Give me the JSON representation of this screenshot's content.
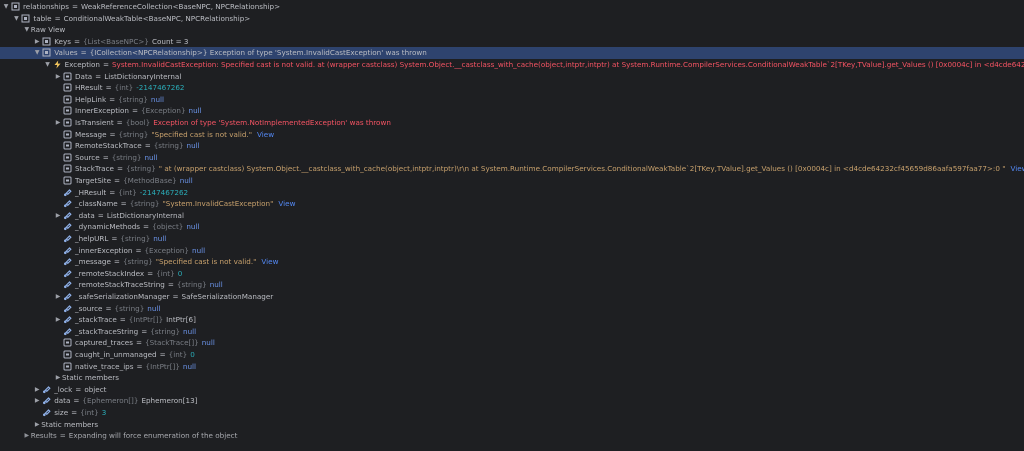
{
  "colors": {
    "background": "#1e1f22",
    "selection": "#2e436e",
    "text": "#bcbec4",
    "type_hint": "#7a7e85",
    "number": "#2aacb8",
    "keyword": "#6c95eb",
    "string": "#c9a26d",
    "error": "#f75464",
    "link": "#548af7"
  },
  "rows": [
    {
      "depth": 0,
      "arrow": "down",
      "icon": "object-icon",
      "name": "relationships",
      "type": "",
      "value": "WeakReferenceCollection<BaseNPC, NPCRelationship>",
      "vclass": "plain",
      "view": ""
    },
    {
      "depth": 1,
      "arrow": "down",
      "icon": "object-icon",
      "name": "table",
      "type": "",
      "value": "ConditionalWeakTable<BaseNPC, NPCRelationship>",
      "vclass": "plain",
      "view": ""
    },
    {
      "depth": 2,
      "arrow": "down",
      "icon": "",
      "name": "Raw View",
      "type": "",
      "value": "",
      "vclass": "plain",
      "view": "",
      "eq": false
    },
    {
      "depth": 3,
      "arrow": "right",
      "icon": "object-icon",
      "name": "Keys",
      "type": "{List<BaseNPC>}",
      "value": "Count = 3",
      "vclass": "plain",
      "view": ""
    },
    {
      "depth": 3,
      "arrow": "down",
      "icon": "object-icon",
      "name": "Values",
      "type": "",
      "value": "{ICollection<NPCRelationship>} Exception of type 'System.InvalidCastException' was thrown",
      "vclass": "plain",
      "view": "",
      "selected": true
    },
    {
      "depth": 4,
      "arrow": "down",
      "icon": "exception-icon",
      "name": "Exception",
      "type": "",
      "value": "System.InvalidCastException: Specified cast is not valid.  at (wrapper castclass) System.Object.__castclass_with_cache(object,intptr,intptr)  at System.Runtime.CompilerServices.ConditionalWeakTable`2[TKey,TValue].get_Values () [0x0004c] in <d4cde64232...",
      "vclass": "err",
      "view": ""
    },
    {
      "depth": 5,
      "arrow": "right",
      "icon": "field-icon",
      "name": "Data",
      "type": "",
      "value": "ListDictionaryInternal",
      "vclass": "plain",
      "view": ""
    },
    {
      "depth": 5,
      "arrow": "none",
      "icon": "field-icon",
      "name": "HResult",
      "type": "{int}",
      "value": "-2147467262",
      "vclass": "num",
      "view": ""
    },
    {
      "depth": 5,
      "arrow": "none",
      "icon": "field-icon",
      "name": "HelpLink",
      "type": "{string}",
      "value": "null",
      "vclass": "kw",
      "view": ""
    },
    {
      "depth": 5,
      "arrow": "none",
      "icon": "field-icon",
      "name": "InnerException",
      "type": "{Exception}",
      "value": "null",
      "vclass": "kw",
      "view": ""
    },
    {
      "depth": 5,
      "arrow": "right",
      "icon": "field-icon",
      "name": "IsTransient",
      "type": "{bool}",
      "value": "Exception of type 'System.NotImplementedException' was thrown",
      "vclass": "err",
      "view": ""
    },
    {
      "depth": 5,
      "arrow": "none",
      "icon": "field-icon",
      "name": "Message",
      "type": "{string}",
      "value": "\"Specified cast is not valid.\"",
      "vclass": "str",
      "view": "View"
    },
    {
      "depth": 5,
      "arrow": "none",
      "icon": "field-icon",
      "name": "RemoteStackTrace",
      "type": "{string}",
      "value": "null",
      "vclass": "kw",
      "view": ""
    },
    {
      "depth": 5,
      "arrow": "none",
      "icon": "field-icon",
      "name": "Source",
      "type": "{string}",
      "value": "null",
      "vclass": "kw",
      "view": ""
    },
    {
      "depth": 5,
      "arrow": "none",
      "icon": "field-icon",
      "name": "StackTrace",
      "type": "{string}",
      "value": "\"  at (wrapper castclass) System.Object.__castclass_with_cache(object,intptr,intptr)\\r\\n  at System.Runtime.CompilerServices.ConditionalWeakTable`2[TKey,TValue].get_Values () [0x0004c] in <d4cde64232cf45659d86aafa597faa77>:0 \"",
      "vclass": "str",
      "view": "View"
    },
    {
      "depth": 5,
      "arrow": "none",
      "icon": "field-icon",
      "name": "TargetSite",
      "type": "{MethodBase}",
      "value": "null",
      "vclass": "kw",
      "view": ""
    },
    {
      "depth": 5,
      "arrow": "none",
      "icon": "private-field-icon",
      "name": "_HResult",
      "type": "{int}",
      "value": "-2147467262",
      "vclass": "num",
      "view": ""
    },
    {
      "depth": 5,
      "arrow": "none",
      "icon": "private-field-icon",
      "name": "_className",
      "type": "{string}",
      "value": "\"System.InvalidCastException\"",
      "vclass": "str",
      "view": "View"
    },
    {
      "depth": 5,
      "arrow": "right",
      "icon": "private-field-icon",
      "name": "_data",
      "type": "",
      "value": "ListDictionaryInternal",
      "vclass": "plain",
      "view": ""
    },
    {
      "depth": 5,
      "arrow": "none",
      "icon": "private-field-icon",
      "name": "_dynamicMethods",
      "type": "{object}",
      "value": "null",
      "vclass": "kw",
      "view": ""
    },
    {
      "depth": 5,
      "arrow": "none",
      "icon": "private-field-icon",
      "name": "_helpURL",
      "type": "{string}",
      "value": "null",
      "vclass": "kw",
      "view": ""
    },
    {
      "depth": 5,
      "arrow": "none",
      "icon": "private-field-icon",
      "name": "_innerException",
      "type": "{Exception}",
      "value": "null",
      "vclass": "kw",
      "view": ""
    },
    {
      "depth": 5,
      "arrow": "none",
      "icon": "private-field-icon",
      "name": "_message",
      "type": "{string}",
      "value": "\"Specified cast is not valid.\"",
      "vclass": "str",
      "view": "View"
    },
    {
      "depth": 5,
      "arrow": "none",
      "icon": "private-field-icon",
      "name": "_remoteStackIndex",
      "type": "{int}",
      "value": "0",
      "vclass": "num",
      "view": ""
    },
    {
      "depth": 5,
      "arrow": "none",
      "icon": "private-field-icon",
      "name": "_remoteStackTraceString",
      "type": "{string}",
      "value": "null",
      "vclass": "kw",
      "view": ""
    },
    {
      "depth": 5,
      "arrow": "right",
      "icon": "private-field-icon",
      "name": "_safeSerializationManager",
      "type": "",
      "value": "SafeSerializationManager",
      "vclass": "plain",
      "view": ""
    },
    {
      "depth": 5,
      "arrow": "none",
      "icon": "private-field-icon",
      "name": "_source",
      "type": "{string}",
      "value": "null",
      "vclass": "kw",
      "view": ""
    },
    {
      "depth": 5,
      "arrow": "right",
      "icon": "private-field-icon",
      "name": "_stackTrace",
      "type": "{IntPtr[]}",
      "value": "IntPtr[6]",
      "vclass": "plain",
      "view": ""
    },
    {
      "depth": 5,
      "arrow": "none",
      "icon": "private-field-icon",
      "name": "_stackTraceString",
      "type": "{string}",
      "value": "null",
      "vclass": "kw",
      "view": ""
    },
    {
      "depth": 5,
      "arrow": "none",
      "icon": "field-icon",
      "name": "captured_traces",
      "type": "{StackTrace[]}",
      "value": "null",
      "vclass": "kw",
      "view": ""
    },
    {
      "depth": 5,
      "arrow": "none",
      "icon": "field-icon",
      "name": "caught_in_unmanaged",
      "type": "{int}",
      "value": "0",
      "vclass": "num",
      "view": ""
    },
    {
      "depth": 5,
      "arrow": "none",
      "icon": "field-icon",
      "name": "native_trace_ips",
      "type": "{IntPtr[]}",
      "value": "null",
      "vclass": "kw",
      "view": ""
    },
    {
      "depth": 5,
      "arrow": "right",
      "icon": "",
      "name": "Static members",
      "type": "",
      "value": "",
      "vclass": "plain",
      "view": "",
      "eq": false
    },
    {
      "depth": 3,
      "arrow": "right",
      "icon": "private-field-icon",
      "name": "_lock",
      "type": "",
      "value": "object",
      "vclass": "plain",
      "view": ""
    },
    {
      "depth": 3,
      "arrow": "right",
      "icon": "private-field-icon",
      "name": "data",
      "type": "{Ephemeron[]}",
      "value": "Ephemeron[13]",
      "vclass": "plain",
      "view": ""
    },
    {
      "depth": 3,
      "arrow": "none",
      "icon": "private-field-icon",
      "name": "size",
      "type": "{int}",
      "value": "3",
      "vclass": "num",
      "view": ""
    },
    {
      "depth": 3,
      "arrow": "right",
      "icon": "",
      "name": "Static members",
      "type": "",
      "value": "",
      "vclass": "plain",
      "view": "",
      "eq": false
    },
    {
      "depth": 2,
      "arrow": "right",
      "icon": "",
      "name": "Results",
      "type": "",
      "value": "Expanding will force enumeration of the object",
      "vclass": "plain",
      "view": ""
    }
  ]
}
